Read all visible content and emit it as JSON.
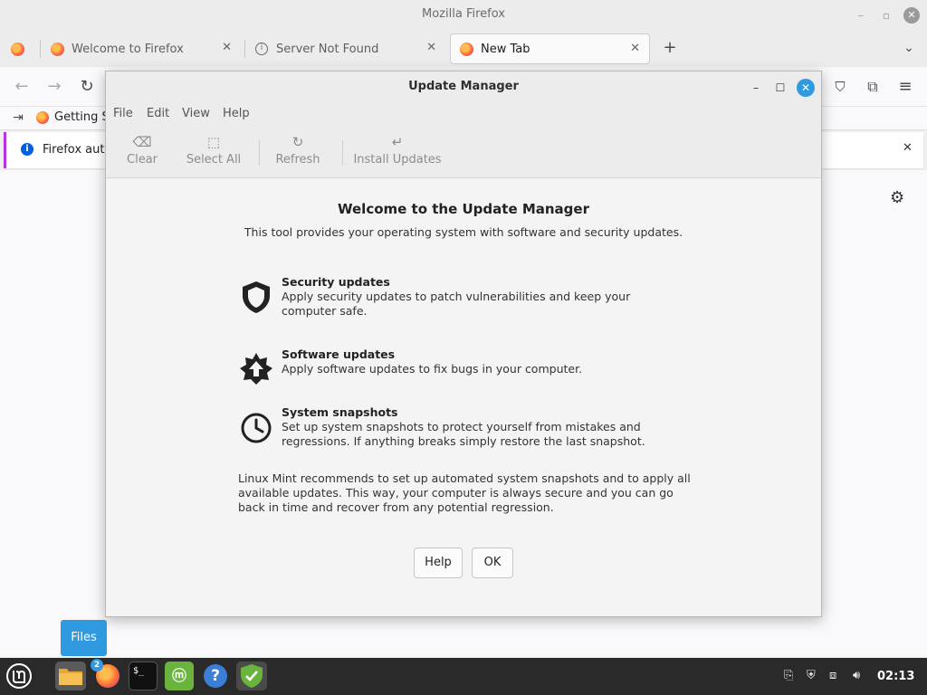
{
  "firefox": {
    "window_title": "Mozilla Firefox",
    "tabs": [
      {
        "label": "Welcome to Firefox"
      },
      {
        "label": "Server Not Found"
      },
      {
        "label": "New Tab"
      }
    ],
    "bookmark": "Getting S",
    "notification": "Firefox auto"
  },
  "update_manager": {
    "title": "Update Manager",
    "menu": [
      "File",
      "Edit",
      "View",
      "Help"
    ],
    "toolbar": {
      "clear": "Clear",
      "select_all": "Select All",
      "refresh": "Refresh",
      "install": "Install Updates"
    },
    "welcome_title": "Welcome to the Update Manager",
    "subtitle": "This tool provides your operating system with software and security updates.",
    "features": [
      {
        "title": "Security updates",
        "desc": "Apply security updates to patch vulnerabilities and keep your computer safe."
      },
      {
        "title": "Software updates",
        "desc": "Apply software updates to fix bugs in your computer."
      },
      {
        "title": "System snapshots",
        "desc": "Set up system snapshots to protect yourself from mistakes and regressions. If anything breaks simply restore the last snapshot."
      }
    ],
    "recommendation": "Linux Mint recommends to set up automated system snapshots and to apply all available updates. This way, your computer is always secure and you can go back in time and recover from any potential regression.",
    "buttons": {
      "help": "Help",
      "ok": "OK"
    }
  },
  "tooltip": "Files",
  "taskbar": {
    "firefox_badge": "2",
    "terminal_prompt": "$_",
    "clock": "02:13"
  },
  "colors": {
    "accent": "#2f9ae0",
    "taskbar": "#2a2a2a",
    "mint_green": "#6ab43e"
  }
}
